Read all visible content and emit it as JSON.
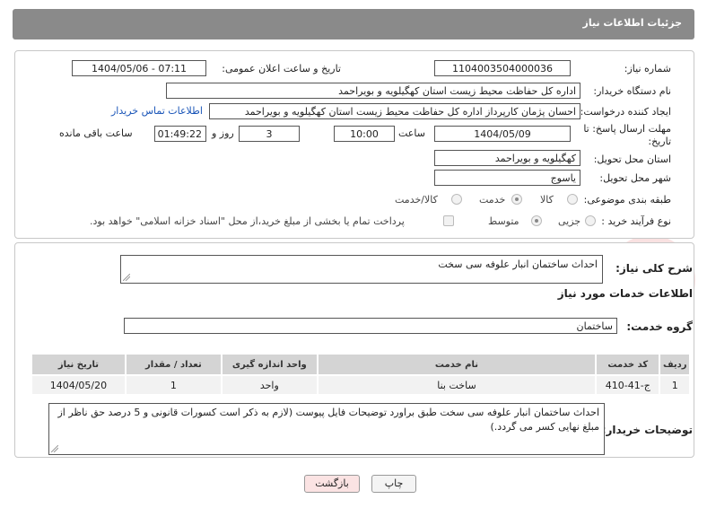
{
  "header": {
    "title": "جزئیات اطلاعات نیاز"
  },
  "fields": {
    "need_number": {
      "label": "شماره نیاز:",
      "value": "1104003504000036"
    },
    "announce_datetime": {
      "label": "تاریخ و ساعت اعلان عمومی:",
      "value": "1404/05/06 - 07:11"
    },
    "buyer_org": {
      "label": "نام دستگاه خریدار:",
      "value": "اداره کل حفاظت محیط زیست استان کهگیلویه و بویراحمد"
    },
    "requester": {
      "label": "ایجاد کننده درخواست:",
      "value": "احسان پژمان کارپرداز اداره کل حفاظت محیط زیست استان کهگیلویه و بویراحمد",
      "contact_link": "اطلاعات تماس خریدار"
    },
    "deadline": {
      "label_line1": "مهلت ارسال پاسخ: تا",
      "label_line2": "تاریخ:",
      "date": "1404/05/09",
      "time_label": "ساعت",
      "time": "10:00",
      "days": "3",
      "days_label": "روز و",
      "remaining": "01:49:22",
      "remaining_label": "ساعت باقی مانده"
    },
    "province": {
      "label": "استان محل تحویل:",
      "value": "کهگیلویه و بویراحمد"
    },
    "city": {
      "label": "شهر محل تحویل:",
      "value": "یاسوج"
    },
    "category": {
      "label": "طبقه بندی موضوعی:",
      "options": [
        "کالا",
        "خدمت",
        "کالا/خدمت"
      ],
      "selected": "خدمت"
    },
    "process": {
      "label": "نوع فرآیند خرید :",
      "options": [
        "جزیی",
        "متوسط"
      ],
      "selected": "متوسط",
      "payment_note": "پرداخت تمام یا بخشی از مبلغ خرید،از محل \"اسناد خزانه اسلامی\" خواهد بود."
    }
  },
  "summary": {
    "label": "شرح کلی نیاز:",
    "value": "احداث ساختمان انبار علوفه سی سخت"
  },
  "services": {
    "section_title": "اطلاعات خدمات مورد نیاز",
    "group_label": "گروه خدمت:",
    "group_value": "ساختمان",
    "table": {
      "headers": [
        "ردیف",
        "کد خدمت",
        "نام خدمت",
        "واحد اندازه گیری",
        "تعداد / مقدار",
        "تاریخ نیاز"
      ],
      "rows": [
        [
          "1",
          "ج-41-410",
          "ساخت بنا",
          "واحد",
          "1",
          "1404/05/20"
        ]
      ]
    }
  },
  "buyer_notes": {
    "label": "توضیحات خریدار:",
    "value": "احداث ساختمان انبار علوفه سی سخت طبق براورد توضیحات فایل پیوست (لازم به ذکر است کسورات قانونی و 5 درصد حق ناظر از مبلغ نهایی کسر می گردد.)"
  },
  "buttons": {
    "print": "چاپ",
    "back": "بازگشت"
  },
  "colors": {
    "header_bg": "#8a8a8a",
    "link": "#1a55b8",
    "back_button_bg": "#fbe3e3",
    "watermark": "#e04b4b"
  },
  "watermark": {
    "text": "AriaTender.neT"
  }
}
